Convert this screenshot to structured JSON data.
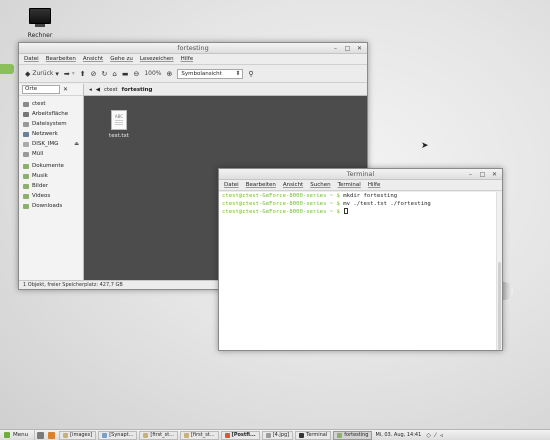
{
  "desktop": {
    "icon_label": "Rechner"
  },
  "file_manager": {
    "title": "fortesting",
    "menu": [
      "Datei",
      "Bearbeiten",
      "Ansicht",
      "Gehe zu",
      "Lesezeichen",
      "Hilfe"
    ],
    "toolbar": {
      "back_label": "Zurück",
      "zoom_value": "100%",
      "view_mode": "Symbolansicht"
    },
    "sidebar": {
      "header": "Orte",
      "items": [
        "ctest",
        "Arbeitsfläche",
        "Dateisystem",
        "Netzwerk",
        "DISK_IMG",
        "Müll",
        "Dokumente",
        "Musik",
        "Bilder",
        "Videos",
        "Downloads"
      ]
    },
    "path": [
      "ctest",
      "fortesting"
    ],
    "file": {
      "name": "test.txt",
      "icon_text": "ABC"
    },
    "status": "1 Objekt, freier Speicherplatz: 427,7 GB"
  },
  "terminal": {
    "title": "Terminal",
    "menu": [
      "Datei",
      "Bearbeiten",
      "Ansicht",
      "Suchen",
      "Terminal",
      "Hilfe"
    ],
    "lines": [
      {
        "prompt": "ctest@ctest-GeForce-8000-series ~ $",
        "cmd": " mkdir fortesting"
      },
      {
        "prompt": "ctest@ctest-GeForce-8000-series ~ $",
        "cmd": " mv ./test.txt ./fortesting"
      },
      {
        "prompt": "ctest@ctest-GeForce-8000-series ~ $",
        "cmd": " "
      }
    ]
  },
  "taskbar": {
    "menu_label": "Menu",
    "tasks": [
      "[images]",
      "[Synapt...",
      "[first_st...",
      "[first_st...",
      "[Postfi...",
      "[4.jpg]",
      "Terminal",
      "fortesting"
    ],
    "clock": "Mi, 03. Aug, 14:41"
  },
  "colors": {
    "prompt": "#6fbf2a",
    "folder_bg": "#4c4c4c",
    "accent": "#6fae3a"
  }
}
